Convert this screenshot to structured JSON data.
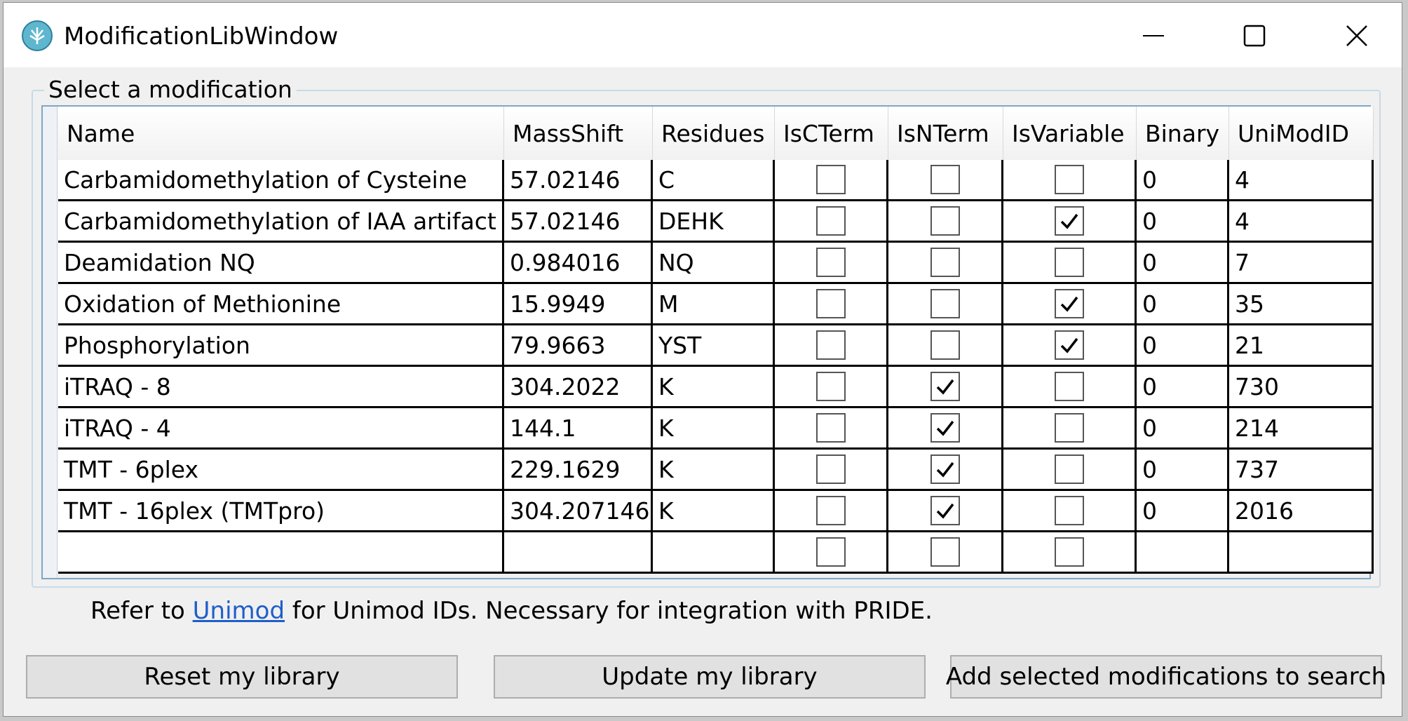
{
  "window": {
    "title": "ModificationLibWindow"
  },
  "group": {
    "label": "Select a modification"
  },
  "table": {
    "columns": [
      "Name",
      "MassShift",
      "Residues",
      "IsCTerm",
      "IsNTerm",
      "IsVariable",
      "Binary",
      "UniModID"
    ],
    "rows": [
      {
        "name": "Carbamidomethylation of Cysteine",
        "mass": "57.02146",
        "residues": "C",
        "cterm": false,
        "nterm": false,
        "variable": false,
        "binary": "0",
        "unimod": "4"
      },
      {
        "name": "Carbamidomethylation of IAA artifact",
        "mass": "57.02146",
        "residues": "DEHK",
        "cterm": false,
        "nterm": false,
        "variable": true,
        "binary": "0",
        "unimod": "4"
      },
      {
        "name": "Deamidation NQ",
        "mass": "0.984016",
        "residues": "NQ",
        "cterm": false,
        "nterm": false,
        "variable": false,
        "binary": "0",
        "unimod": "7"
      },
      {
        "name": "Oxidation of Methionine",
        "mass": "15.9949",
        "residues": "M",
        "cterm": false,
        "nterm": false,
        "variable": true,
        "binary": "0",
        "unimod": "35"
      },
      {
        "name": "Phosphorylation",
        "mass": "79.9663",
        "residues": "YST",
        "cterm": false,
        "nterm": false,
        "variable": true,
        "binary": "0",
        "unimod": "21"
      },
      {
        "name": "iTRAQ - 8",
        "mass": "304.2022",
        "residues": "K",
        "cterm": false,
        "nterm": true,
        "variable": false,
        "binary": "0",
        "unimod": "730"
      },
      {
        "name": "iTRAQ - 4",
        "mass": "144.1",
        "residues": "K",
        "cterm": false,
        "nterm": true,
        "variable": false,
        "binary": "0",
        "unimod": "214"
      },
      {
        "name": "TMT - 6plex",
        "mass": "229.1629",
        "residues": "K",
        "cterm": false,
        "nterm": true,
        "variable": false,
        "binary": "0",
        "unimod": "737"
      },
      {
        "name": "TMT - 16plex (TMTpro)",
        "mass": "304.207146",
        "residues": "K",
        "cterm": false,
        "nterm": true,
        "variable": false,
        "binary": "0",
        "unimod": "2016"
      },
      {
        "name": "",
        "mass": "",
        "residues": "",
        "cterm": false,
        "nterm": false,
        "variable": false,
        "binary": "",
        "unimod": ""
      }
    ]
  },
  "info": {
    "prefix": "Refer to",
    "link": "Unimod",
    "suffix": "for Unimod IDs. Necessary for integration with PRIDE."
  },
  "buttons": {
    "reset": "Reset my library",
    "update": "Update my library",
    "add": "Add selected modifications to search"
  },
  "colors": {
    "link": "#1f5fc9",
    "accent_border": "#7ea7c6"
  },
  "icons": {
    "app": "app-icon",
    "minimize": "minimize-icon",
    "maximize": "maximize-icon",
    "close": "close-icon",
    "check": "checkmark-icon"
  }
}
